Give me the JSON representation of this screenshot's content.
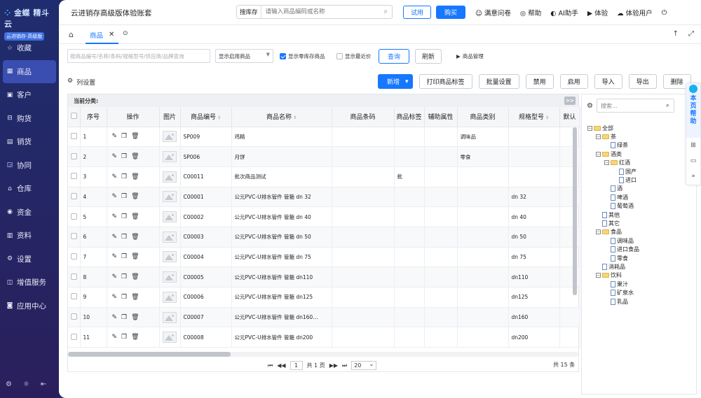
{
  "brand": {
    "name": "金蝶 精斗云",
    "sub": "云进销存·高级版"
  },
  "sidebar": {
    "items": [
      {
        "icon": "star-icon",
        "glyph": "☆",
        "label": "收藏"
      },
      {
        "icon": "goods-icon",
        "glyph": "▦",
        "label": "商品",
        "active": true
      },
      {
        "icon": "customer-icon",
        "glyph": "▣",
        "label": "客户"
      },
      {
        "icon": "cart-icon",
        "glyph": "⊟",
        "label": "购货"
      },
      {
        "icon": "sales-icon",
        "glyph": "▤",
        "label": "销货"
      },
      {
        "icon": "collab-icon",
        "glyph": "◲",
        "label": "协同"
      },
      {
        "icon": "warehouse-icon",
        "glyph": "⌂",
        "label": "仓库"
      },
      {
        "icon": "money-icon",
        "glyph": "◉",
        "label": "资金"
      },
      {
        "icon": "data-icon",
        "glyph": "▥",
        "label": "资料"
      },
      {
        "icon": "settings-icon",
        "glyph": "⚙",
        "label": "设置"
      },
      {
        "icon": "vas-icon",
        "glyph": "◫",
        "label": "增值服务"
      },
      {
        "icon": "app-center-icon",
        "glyph": "◙",
        "label": "应用中心"
      }
    ]
  },
  "topbar": {
    "company": "云进销存高级版体验账套",
    "search_tag": "搜库存",
    "search_placeholder": "请输入商品编码或名称",
    "try_label": "试用",
    "buy_label": "购买",
    "links": [
      {
        "icon": "smile-icon",
        "glyph": "☺",
        "label": "满意问卷"
      },
      {
        "icon": "help-icon",
        "glyph": "◎",
        "label": "帮助"
      },
      {
        "icon": "ai-icon",
        "glyph": "◐",
        "label": "AI助手"
      },
      {
        "icon": "play-icon",
        "glyph": "▶",
        "label": "体验"
      },
      {
        "icon": "cloud-user-icon",
        "glyph": "☁",
        "label": "体验用户"
      },
      {
        "icon": "logout-icon",
        "glyph": "⏻",
        "label": ""
      }
    ]
  },
  "tabs": {
    "active": "商品"
  },
  "filter": {
    "keyword_placeholder": "按商品编号/名称/条码/规格型号/供应商/品牌查询",
    "status_select": "显示启用商品",
    "show_zero_stock": "显示零库存商品",
    "show_recent_price": "显示最近价",
    "query": "查询",
    "refresh": "刷新",
    "goods_mgr": "商品管理"
  },
  "toolbar": {
    "col_settings": "列设置",
    "buttons": [
      "新增",
      "打印商品标签",
      "批量设置",
      "禁用",
      "启用",
      "导入",
      "导出",
      "删除"
    ]
  },
  "grid": {
    "category_label": "当前分类:",
    "expand": ">>",
    "headers": [
      "序号",
      "操作",
      "图片",
      "商品编号",
      "商品名称",
      "商品条码",
      "商品标签",
      "辅助属性",
      "商品类别",
      "规格型号",
      "默认"
    ],
    "rows": [
      {
        "no": "1",
        "code": "SP009",
        "name": "鸡精",
        "barcode": "",
        "tag": "",
        "attr": "",
        "category": "调味品",
        "spec": ""
      },
      {
        "no": "2",
        "code": "SP006",
        "name": "月饼",
        "barcode": "",
        "tag": "",
        "attr": "",
        "category": "零食",
        "spec": ""
      },
      {
        "no": "3",
        "code": "C00011",
        "name": "批次商品测试",
        "barcode": "",
        "tag": "批",
        "attr": "",
        "category": "",
        "spec": ""
      },
      {
        "no": "4",
        "code": "C00001",
        "name": "公元PVC-U排水管件 管箍 dn 32",
        "barcode": "",
        "tag": "",
        "attr": "",
        "category": "",
        "spec": "dn 32"
      },
      {
        "no": "5",
        "code": "C00002",
        "name": "公元PVC-U排水管件 管箍 dn 40",
        "barcode": "",
        "tag": "",
        "attr": "",
        "category": "",
        "spec": "dn 40"
      },
      {
        "no": "6",
        "code": "C00003",
        "name": "公元PVC-U排水管件 管箍 dn 50",
        "barcode": "",
        "tag": "",
        "attr": "",
        "category": "",
        "spec": "dn 50"
      },
      {
        "no": "7",
        "code": "C00004",
        "name": "公元PVC-U排水管件 管箍 dn 75",
        "barcode": "",
        "tag": "",
        "attr": "",
        "category": "",
        "spec": "dn 75"
      },
      {
        "no": "8",
        "code": "C00005",
        "name": "公元PVC-U排水管件 管箍 dn110",
        "barcode": "",
        "tag": "",
        "attr": "",
        "category": "",
        "spec": "dn110"
      },
      {
        "no": "9",
        "code": "C00006",
        "name": "公元PVC-U排水管件 管箍 dn125",
        "barcode": "",
        "tag": "",
        "attr": "",
        "category": "",
        "spec": "dn125"
      },
      {
        "no": "10",
        "code": "C00007",
        "name": "公元PVC-U排水管件 管箍 dn160…",
        "barcode": "",
        "tag": "",
        "attr": "",
        "category": "",
        "spec": "dn160"
      },
      {
        "no": "11",
        "code": "C00008",
        "name": "公元PVC-U排水管件 管箍 dn200",
        "barcode": "",
        "tag": "",
        "attr": "",
        "category": "",
        "spec": "dn200"
      }
    ]
  },
  "pager": {
    "page": "1",
    "total_pages": "共 1 页",
    "page_size": "20",
    "total": "共 15 条"
  },
  "tree": {
    "search_placeholder": "搜索...",
    "nodes": [
      {
        "label": "全部",
        "level": 0,
        "folder": true
      },
      {
        "label": "茶",
        "level": 1,
        "folder": true
      },
      {
        "label": "绿茶",
        "level": 2,
        "folder": false
      },
      {
        "label": "酒类",
        "level": 1,
        "folder": true
      },
      {
        "label": "红酒",
        "level": 2,
        "folder": true
      },
      {
        "label": "国产",
        "level": 3,
        "folder": false
      },
      {
        "label": "进口",
        "level": 3,
        "folder": false
      },
      {
        "label": "酒",
        "level": 2,
        "folder": false
      },
      {
        "label": "啤酒",
        "level": 2,
        "folder": false
      },
      {
        "label": "葡萄酒",
        "level": 2,
        "folder": false
      },
      {
        "label": "其他",
        "level": 1,
        "folder": false
      },
      {
        "label": "其它",
        "level": 1,
        "folder": false
      },
      {
        "label": "食品",
        "level": 1,
        "folder": true
      },
      {
        "label": "调味品",
        "level": 2,
        "folder": false
      },
      {
        "label": "进口食品",
        "level": 2,
        "folder": false
      },
      {
        "label": "零食",
        "level": 2,
        "folder": false
      },
      {
        "label": "消耗品",
        "level": 1,
        "folder": false
      },
      {
        "label": "饮料",
        "level": 1,
        "folder": true
      },
      {
        "label": "果汁",
        "level": 2,
        "folder": false
      },
      {
        "label": "矿泉水",
        "level": 2,
        "folder": false
      },
      {
        "label": "乳品",
        "level": 2,
        "folder": false
      }
    ]
  },
  "help_float": {
    "label": "本页帮助"
  }
}
